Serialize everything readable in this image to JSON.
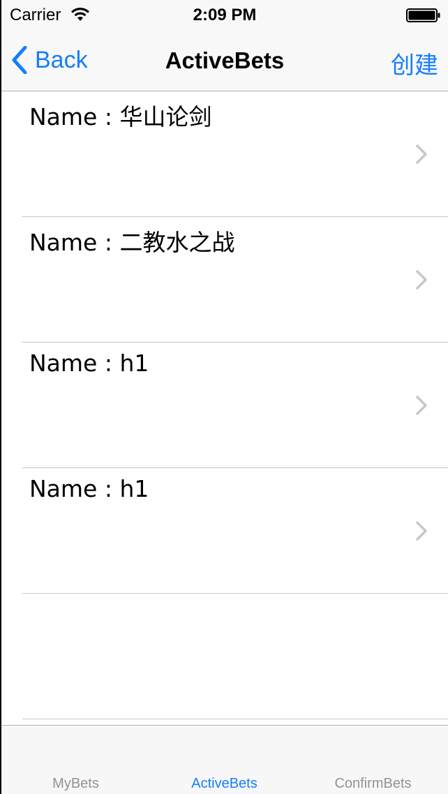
{
  "status_bar": {
    "carrier": "Carrier",
    "time": "2:09 PM"
  },
  "nav": {
    "back_label": "Back",
    "title": "ActiveBets",
    "create_label": "创建"
  },
  "rows": [
    {
      "label": "Name : 华山论剑"
    },
    {
      "label": "Name : 二教水之战"
    },
    {
      "label": "Name : h1"
    },
    {
      "label": "Name : h1"
    }
  ],
  "tabs": [
    {
      "label": "MyBets",
      "active": false
    },
    {
      "label": "ActiveBets",
      "active": true
    },
    {
      "label": "ConfirmBets",
      "active": false
    }
  ],
  "colors": {
    "accent": "#157efb",
    "tab_inactive": "#929292",
    "separator": "#c8c7cc",
    "chevron": "#c7c7cc"
  },
  "icons": [
    "wifi-icon",
    "battery-icon",
    "back-chevron-icon",
    "chevron-right-icon"
  ]
}
